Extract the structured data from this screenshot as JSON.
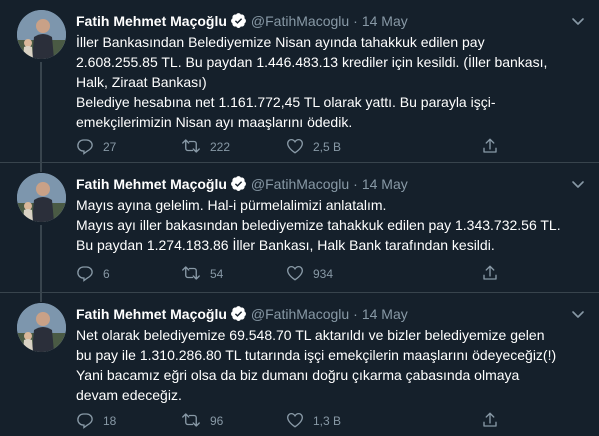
{
  "tweets": [
    {
      "author_name": "Fatih Mehmet Maçoğlu",
      "handle": "@FatihMacoglu",
      "separator": "·",
      "date": "14 May",
      "lines": [
        "İller Bankasından Belediyemize Nisan ayında tahakkuk edilen pay",
        "2.608.255.85 TL. Bu paydan 1.446.483.13 krediler için kesildi. (İller bankası,",
        "Halk, Ziraat Bankası)",
        "Belediye hesabına net 1.161.772,45 TL olarak yattı. Bu parayla işçi-",
        "emekçilerimizin Nisan ayı maaşlarını ödedik."
      ],
      "replies": "27",
      "retweets": "222",
      "likes": "2,5 B"
    },
    {
      "author_name": "Fatih Mehmet Maçoğlu",
      "handle": "@FatihMacoglu",
      "separator": "·",
      "date": "14 May",
      "lines": [
        "Mayıs ayına gelelim. Hal-i pürmelalimizi anlatalım.",
        "Mayıs ayı iller bakasından belediyemize tahakkuk edilen pay 1.343.732.56 TL.",
        "Bu paydan 1.274.183.86 İller Bankası, Halk Bank tarafından kesildi."
      ],
      "replies": "6",
      "retweets": "54",
      "likes": "934"
    },
    {
      "author_name": "Fatih Mehmet Maçoğlu",
      "handle": "@FatihMacoglu",
      "separator": "·",
      "date": "14 May",
      "lines": [
        "Net olarak belediyemize 69.548.70 TL aktarıldı ve bizler belediyemize gelen",
        "bu pay ile 1.310.286.80 TL tutarında işçi emekçilerin maaşlarını ödeyeceğiz(!)",
        "Yani bacamız eğri olsa da biz dumanı doğru çıkarma çabasında olmaya",
        "devam edeceğiz."
      ],
      "replies": "18",
      "retweets": "96",
      "likes": "1,3 B"
    }
  ],
  "icons": {
    "reply": "reply-icon",
    "retweet": "retweet-icon",
    "like": "like-icon",
    "share": "share-icon",
    "verified": "verified-badge-icon",
    "caret": "chevron-down-icon"
  },
  "colors": {
    "background": "#15202b",
    "text": "#ffffff",
    "secondary": "#8899a6",
    "divider": "#38444d",
    "verified": "#1da1f2"
  }
}
